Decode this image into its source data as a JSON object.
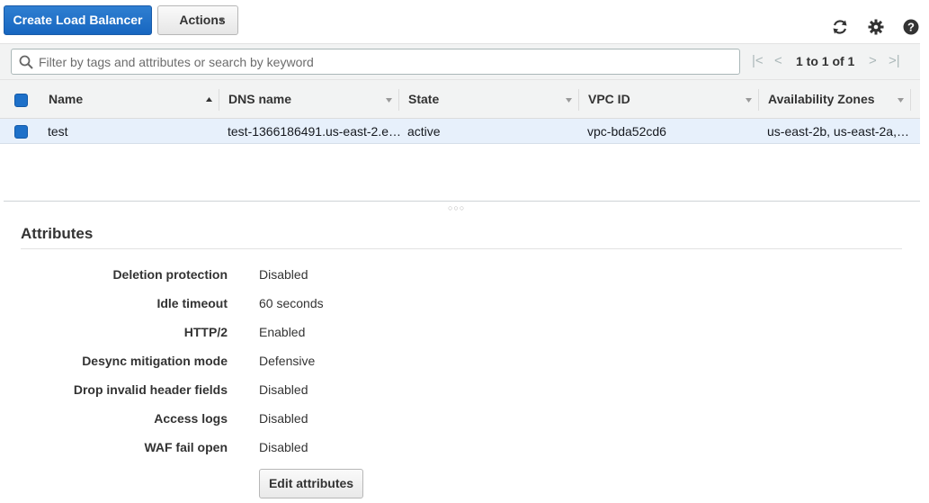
{
  "toolbar": {
    "create_label": "Create Load Balancer",
    "actions_label": "Actions",
    "actions_chevron": "▾",
    "refresh_icon": "refresh-icon",
    "settings_icon": "gear-icon",
    "help_icon": "help-icon"
  },
  "filter": {
    "placeholder": "Filter by tags and attributes or search by keyword",
    "pagination_text": "1 to 1 of 1"
  },
  "table": {
    "columns": [
      "Name",
      "DNS name",
      "State",
      "VPC ID",
      "Availability Zones"
    ],
    "rows": [
      {
        "name": "test",
        "dns": "test-1366186491.us-east-2.e…",
        "state": "active",
        "vpc": "vpc-bda52cd6",
        "zones": "us-east-2b, us-east-2a,…"
      }
    ]
  },
  "attributes": {
    "title": "Attributes",
    "items": [
      {
        "label": "Deletion protection",
        "value": "Disabled"
      },
      {
        "label": "Idle timeout",
        "value": "60 seconds"
      },
      {
        "label": "HTTP/2",
        "value": "Enabled"
      },
      {
        "label": "Desync mitigation mode",
        "value": "Defensive"
      },
      {
        "label": "Drop invalid header fields",
        "value": "Disabled"
      },
      {
        "label": "Access logs",
        "value": "Disabled"
      },
      {
        "label": "WAF fail open",
        "value": "Disabled"
      }
    ],
    "edit_label": "Edit attributes"
  },
  "colors": {
    "primary": "#1766c0",
    "row_selected": "#e7f0fb",
    "header_bg": "#f2f3f3"
  }
}
